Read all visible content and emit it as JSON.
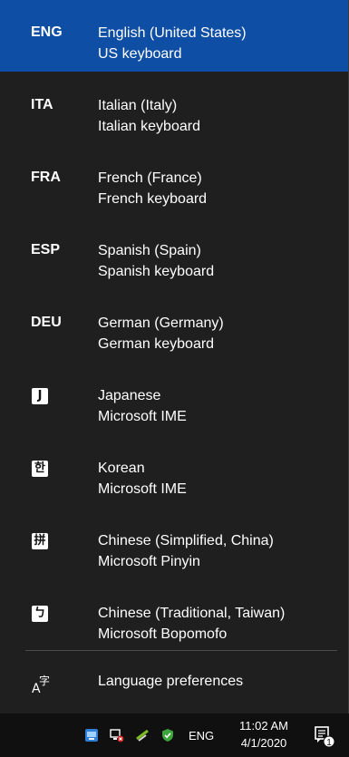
{
  "languages": [
    {
      "code": "ENG",
      "name": "English (United States)",
      "keyboard": "US keyboard",
      "selected": true
    },
    {
      "code": "ITA",
      "name": "Italian (Italy)",
      "keyboard": "Italian keyboard"
    },
    {
      "code": "FRA",
      "name": "French (France)",
      "keyboard": "French keyboard"
    },
    {
      "code": "ESP",
      "name": "Spanish (Spain)",
      "keyboard": "Spanish keyboard"
    },
    {
      "code": "DEU",
      "name": "German (Germany)",
      "keyboard": "German keyboard"
    },
    {
      "glyph": "J",
      "name": "Japanese",
      "keyboard": "Microsoft IME"
    },
    {
      "glyph": "한",
      "name": "Korean",
      "keyboard": "Microsoft IME"
    },
    {
      "glyph": "拼",
      "name": "Chinese (Simplified, China)",
      "keyboard": "Microsoft Pinyin"
    },
    {
      "glyph": "ㄅ",
      "name": "Chinese (Traditional, Taiwan)",
      "keyboard": "Microsoft Bopomofo"
    }
  ],
  "preferences": {
    "label": "Language preferences",
    "icon": "language-preferences-icon"
  },
  "taskbar": {
    "lang": "ENG",
    "time": "11:02 AM",
    "date": "4/1/2020",
    "notification_count": "1"
  },
  "colors": {
    "accent": "#0f4ea5",
    "flyout_bg": "#1f1f1f",
    "taskbar_bg": "#101010"
  }
}
